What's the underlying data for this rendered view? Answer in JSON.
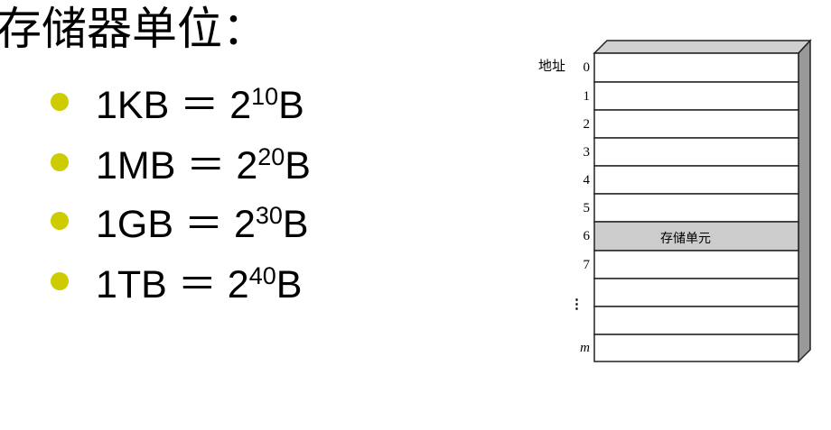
{
  "title": "存储器单位：",
  "bullets": [
    {
      "lhs": "1KB",
      "eq": "＝",
      "base": "2",
      "exp": "10",
      "unit": "B"
    },
    {
      "lhs": "1MB",
      "eq": "＝",
      "base": "2",
      "exp": "20",
      "unit": "B"
    },
    {
      "lhs": "1GB",
      "eq": "＝",
      "base": "2",
      "exp": "30",
      "unit": "B"
    },
    {
      "lhs": "1TB",
      "eq": "＝",
      "base": "2",
      "exp": "40",
      "unit": "B"
    }
  ],
  "bullet_color": "#cccc00",
  "diagram": {
    "address_label": "地址",
    "row_labels": [
      "0",
      "1",
      "2",
      "3",
      "4",
      "5",
      "6",
      "7",
      "",
      "",
      ""
    ],
    "ellipsis": "⋮",
    "last_label": "m",
    "highlighted_cell_text": "存储单元",
    "highlight_color": "#cccccc"
  }
}
